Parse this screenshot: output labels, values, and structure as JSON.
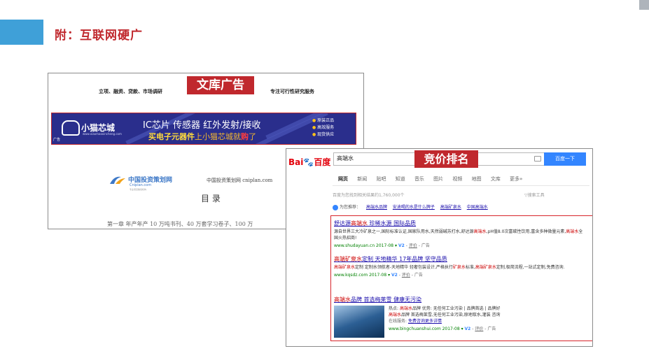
{
  "slide": {
    "title": "附：互联网硬广"
  },
  "wenku": {
    "tag": "文库广告",
    "nav_left": "立项、融资、贷款、市场调研",
    "nav_right": "专注可行性研究服务",
    "banner": {
      "brand": "小猫芯城",
      "brand_url": "www.xiaomaoxincheng.com",
      "headline": "IC芯片 传感器 红外发射/接收",
      "sub_prefix": "买电子元器件",
      "sub_mid": "上小猫芯城就",
      "sub_buy": "购",
      "sub_suffix": "了",
      "badges": [
        "原装正品",
        "高效服务",
        "现货供应"
      ],
      "ad_mark": "广告"
    },
    "cip_name": "中国投资策划网",
    "cip_url": "Cniplan.com",
    "cip_sub": "专业项目策划机构",
    "cip_right": "中国投资策划网  cniplan.com",
    "toc_title": "目 录",
    "toc_line": "第一章  年产年产 10 万吨书刊、40 万套学习卷子、100 万"
  },
  "baidu": {
    "tag": "竞价排名",
    "logo_bai": "Bai",
    "logo_du": "百度",
    "query": "高端水",
    "search_button": "百度一下",
    "tabs": [
      "网页",
      "新闻",
      "贴吧",
      "知道",
      "音乐",
      "图片",
      "视频",
      "地图",
      "文库",
      "更多»"
    ],
    "result_count": "百度为您找到相关结果约1,760,000个",
    "tools": "搜索工具",
    "rec_label": "为您推荐：",
    "rec_links": [
      "高端水品牌",
      "安迪喝的水是什么牌子",
      "高端矿泉水",
      "中国高端水"
    ],
    "ads": [
      {
        "title_a": "舒达源",
        "title_em": "高端水",
        "title_b": " 珍稀水源 国际品质",
        "desc_a": "源自世界三大冷矿泉之一,国际标准认证,国家队用水,天然弱碱苏打水,舒达源",
        "desc_em": "高端水",
        "desc_b": ",pH值8.0次富碳性饮用,富含多种微量元素,",
        "desc_em2": "高端水",
        "desc_c": "全国火热招商!",
        "url": "www.shudayuan.cn  2017-08",
        "v": "V2",
        "eval": "评价",
        "ad": "广告"
      },
      {
        "title_a": "高端矿泉水",
        "title_b": "定制 天地精华 17年品牌 坚守品质",
        "desc_em": "高端矿泉水",
        "desc_a": "定制 定制水领航者-天地精华 轻奢包装设计,严格执行",
        "desc_em2": "矿泉水",
        "desc_b": "标准,",
        "desc_em3": "高端矿泉水",
        "desc_c": "定制,极简流程,一站式定制,免费咨询.",
        "url": "www.kqsdz.com  2017-08",
        "v": "V2",
        "eval": "评价",
        "ad": "广告"
      },
      {
        "title_em": "高端水",
        "title_b": "品牌 首选梅莱雪 健康无污染",
        "line1_a": "热点: ",
        "line1_em": "高端水",
        "line1_b": "品牌   优势: 无任何工业污染 | 品牌首选 | 品牌好",
        "line2_em": "高端水",
        "line2_b": "品牌 首选梅莱雪,无任何工业污染,原地取水,灌装 咨询",
        "line3_a": "在线服务: ",
        "line3_link": "免费咨询更多详情",
        "url": "www.bingchuanshui.com  2017-08",
        "v": "V2",
        "eval": "评价",
        "ad": "广告"
      }
    ]
  },
  "colors": {
    "accent_blue": "#3fa0d8",
    "title_red": "#c0282d",
    "baidu_blue": "#3385ff",
    "link_blue": "#1a0dab",
    "url_green": "#008000"
  }
}
